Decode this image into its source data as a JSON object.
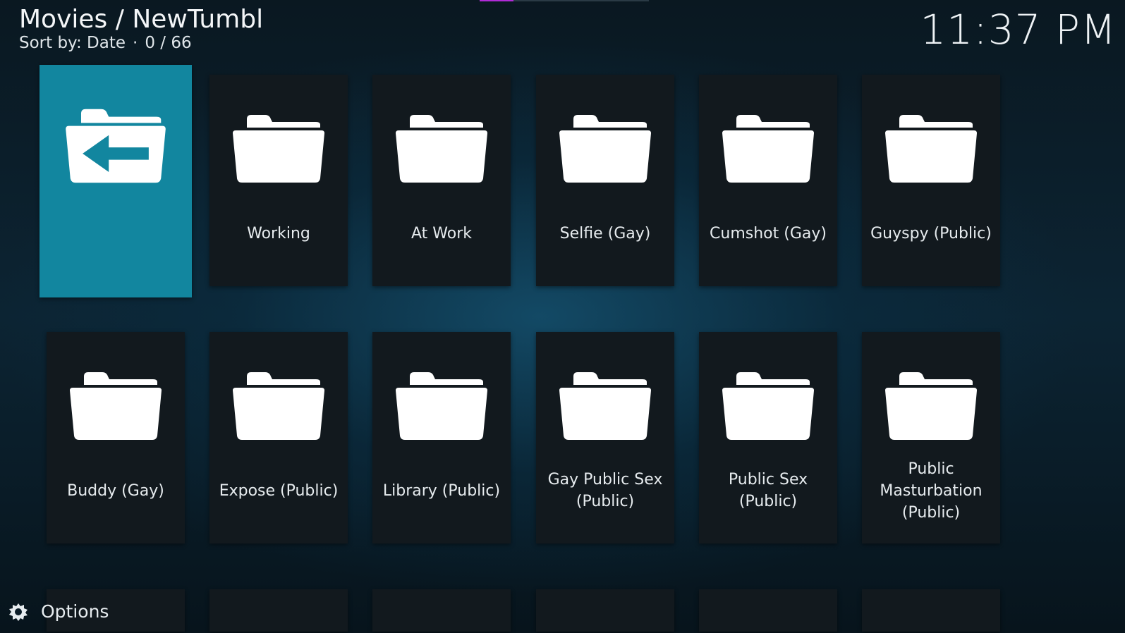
{
  "header": {
    "title": "Movies / NewTumbl",
    "sort_label": "Sort by: Date",
    "separator": "·",
    "position": "0 / 66"
  },
  "clock": "11:37 PM",
  "progress": {
    "fraction": 0.2,
    "color": "#b02bd6"
  },
  "tiles": [
    {
      "label": "",
      "icon": "folder-back-icon",
      "focused": true
    },
    {
      "label": "Working",
      "icon": "folder-icon"
    },
    {
      "label": "At Work",
      "icon": "folder-icon"
    },
    {
      "label": "Selfie (Gay)",
      "icon": "folder-icon"
    },
    {
      "label": "Cumshot (Gay)",
      "icon": "folder-icon"
    },
    {
      "label": "Guyspy (Public)",
      "icon": "folder-icon"
    },
    {
      "label": "Buddy (Gay)",
      "icon": "folder-icon"
    },
    {
      "label": "Expose (Public)",
      "icon": "folder-icon"
    },
    {
      "label": "Library (Public)",
      "icon": "folder-icon"
    },
    {
      "label": "Gay Public Sex (Public)",
      "icon": "folder-icon"
    },
    {
      "label": "Public Sex (Public)",
      "icon": "folder-icon"
    },
    {
      "label": "Public Masturbation (Public)",
      "icon": "folder-icon"
    }
  ],
  "options": {
    "label": "Options",
    "icon": "gear-icon"
  },
  "colors": {
    "focus": "#12869f",
    "tile": "#12191e"
  }
}
